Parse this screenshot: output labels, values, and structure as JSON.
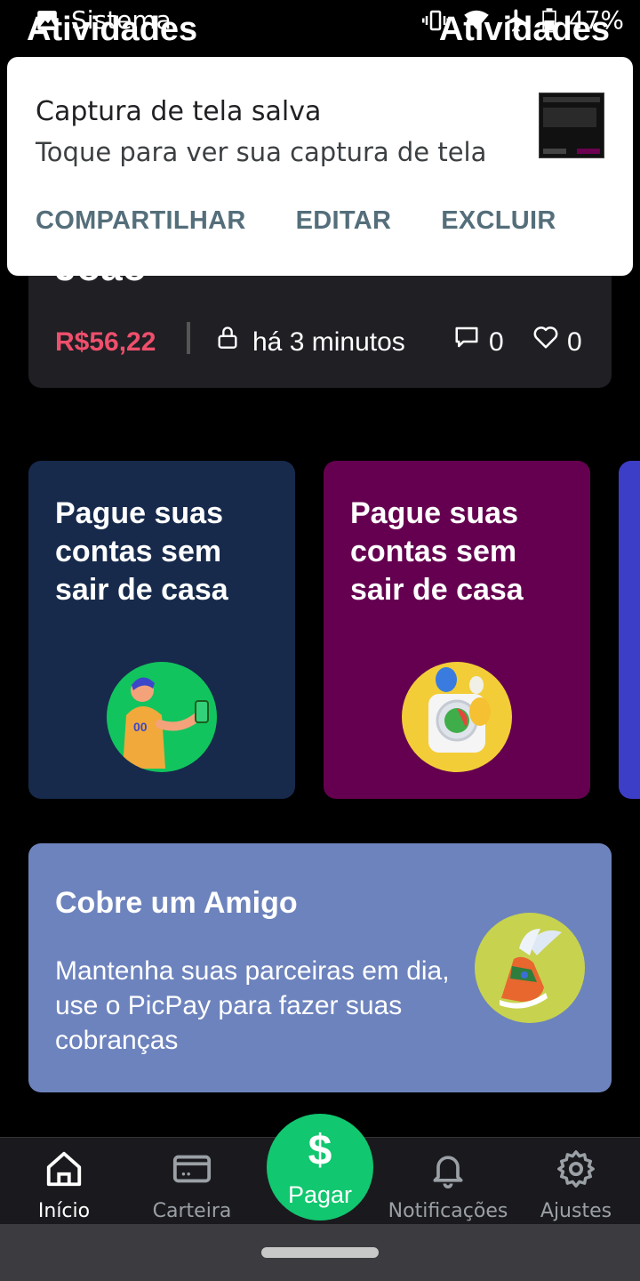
{
  "status_bar": {
    "app_name": "Sistema",
    "battery": "47%"
  },
  "header": {
    "left_title": "Atividades",
    "right_title": "Atividades"
  },
  "notification": {
    "title": "Captura de tela salva",
    "text": "Toque para ver sua captura de tela",
    "actions": [
      "COMPARTILHAR",
      "EDITAR",
      "EXCLUIR"
    ]
  },
  "activity": {
    "name_partial": "João",
    "price": "R$56,22",
    "time": "há 3 minutos",
    "comments": "0",
    "likes": "0"
  },
  "promos": [
    {
      "title": "Pague suas contas sem sair de casa",
      "bg": "#172a4c",
      "circle": "#12c45e"
    },
    {
      "title": "Pague suas contas sem sair de casa",
      "bg": "#650050",
      "circle": "#f2cd38"
    }
  ],
  "charge_card": {
    "title": "Cobre um Amigo",
    "text": "Mantenha suas parceiras em dia, use o PicPay para fazer suas cobranças"
  },
  "nav": {
    "items": [
      {
        "label": "Início",
        "icon": "home-icon"
      },
      {
        "label": "Carteira",
        "icon": "wallet-icon"
      },
      {
        "label": "Notificações",
        "icon": "bell-icon"
      },
      {
        "label": "Ajustes",
        "icon": "gear-icon"
      }
    ],
    "pay": {
      "symbol": "$",
      "label": "Pagar"
    }
  },
  "colors": {
    "accent_green": "#11c76f",
    "price_red": "#ef4f6c"
  }
}
